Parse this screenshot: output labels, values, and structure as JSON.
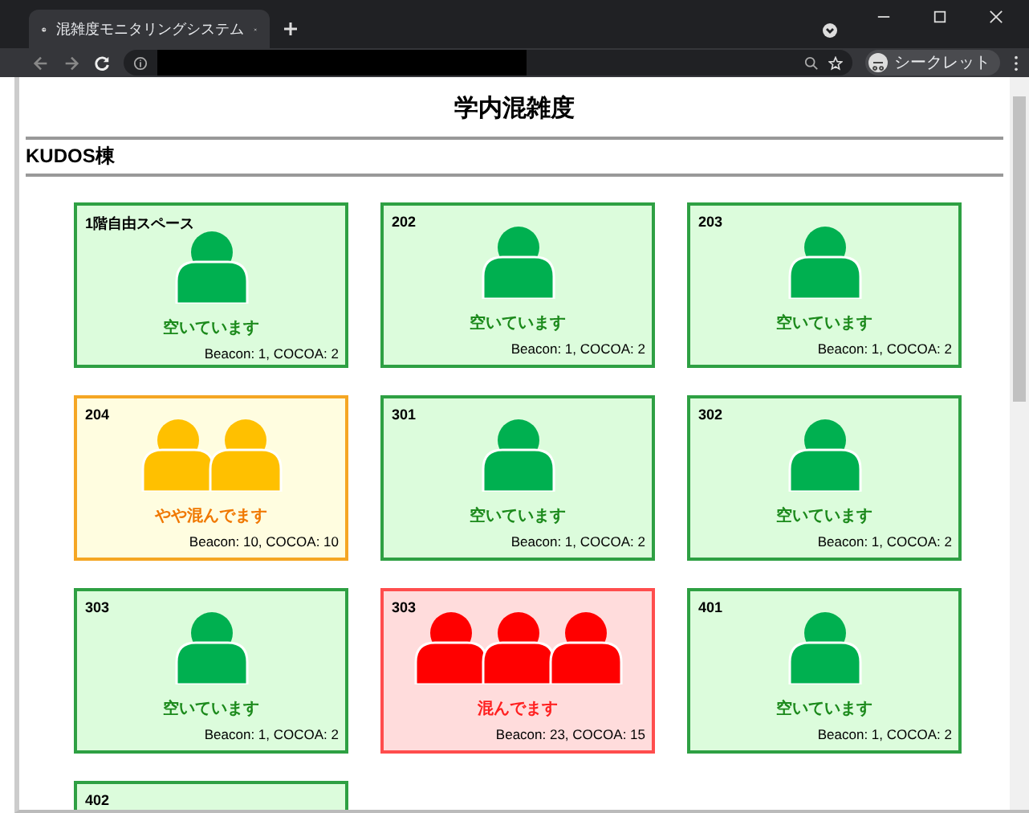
{
  "browser": {
    "tab_title": "混雑度モニタリングシステム",
    "profile_label": "シークレット"
  },
  "page": {
    "title": "学内混雑度",
    "building": "KUDOS棟"
  },
  "rooms": [
    {
      "name": "1階自由スペース",
      "kind": "empty",
      "status": "空いています",
      "counts": "Beacon: 1, COCOA: 2"
    },
    {
      "name": "202",
      "kind": "empty",
      "status": "空いています",
      "counts": "Beacon: 1, COCOA: 2"
    },
    {
      "name": "203",
      "kind": "empty",
      "status": "空いています",
      "counts": "Beacon: 1, COCOA: 2"
    },
    {
      "name": "204",
      "kind": "medium",
      "status": "やや混んでます",
      "counts": "Beacon: 10, COCOA: 10"
    },
    {
      "name": "301",
      "kind": "empty",
      "status": "空いています",
      "counts": "Beacon: 1, COCOA: 2"
    },
    {
      "name": "302",
      "kind": "empty",
      "status": "空いています",
      "counts": "Beacon: 1, COCOA: 2"
    },
    {
      "name": "303",
      "kind": "empty",
      "status": "空いています",
      "counts": "Beacon: 1, COCOA: 2"
    },
    {
      "name": "303",
      "kind": "crowded",
      "status": "混んでます",
      "counts": "Beacon: 23, COCOA: 15"
    },
    {
      "name": "401",
      "kind": "empty",
      "status": "空いています",
      "counts": "Beacon: 1, COCOA: 2"
    },
    {
      "name": "402",
      "kind": "empty"
    }
  ]
}
